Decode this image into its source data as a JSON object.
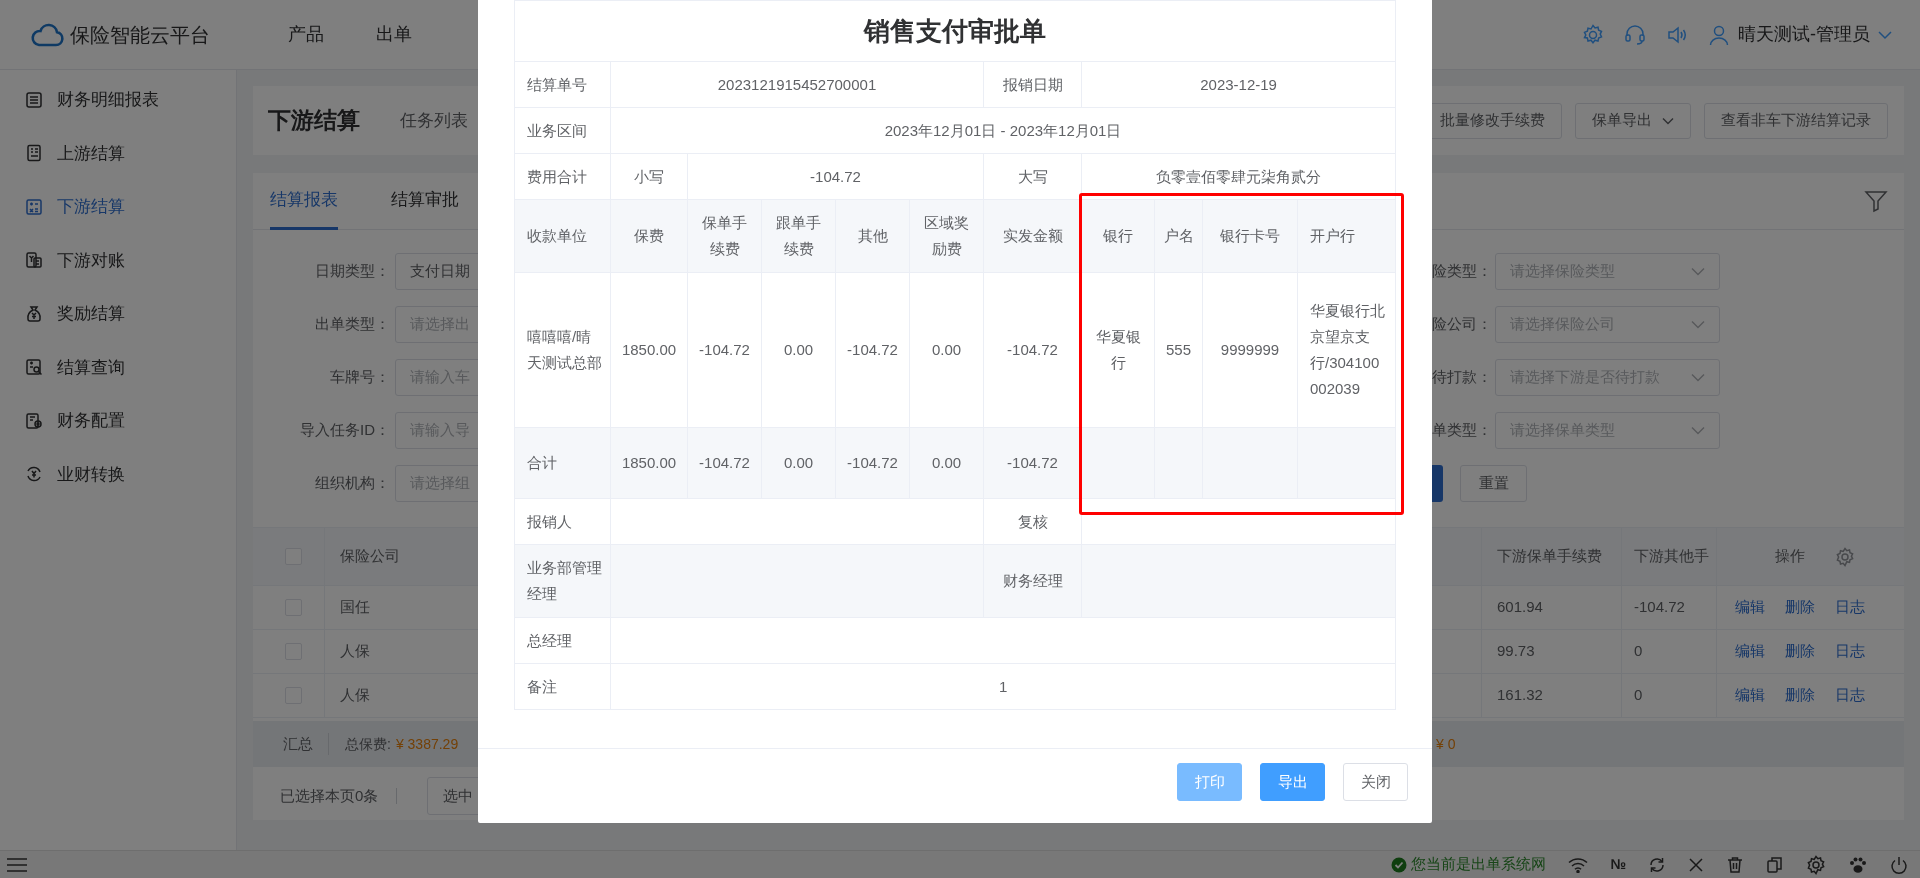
{
  "app": {
    "logo": "保险智能云平台",
    "nav": [
      {
        "label": "产品"
      },
      {
        "label": "出单"
      }
    ],
    "user": "晴天测试-管理员"
  },
  "sidebar": {
    "items": [
      {
        "label": "财务明细报表",
        "selected": false
      },
      {
        "label": "上游结算",
        "selected": false
      },
      {
        "label": "下游结算",
        "selected": true
      },
      {
        "label": "下游对账",
        "selected": false
      },
      {
        "label": "奖励结算",
        "selected": false
      },
      {
        "label": "结算查询",
        "selected": false
      },
      {
        "label": "财务配置",
        "selected": false
      },
      {
        "label": "业财转换",
        "selected": false
      }
    ]
  },
  "header": {
    "title": "下游结算",
    "breadcrumb": "任务列表",
    "actions": [
      {
        "label": "批量修改手续费",
        "kind": "button"
      },
      {
        "label": "保单导出",
        "kind": "dropdown"
      },
      {
        "label": "查看非车下游结算记录",
        "kind": "button"
      }
    ]
  },
  "tabs": [
    {
      "label": "结算报表",
      "selected": true
    },
    {
      "label": "结算审批",
      "selected": false
    }
  ],
  "filters_left": [
    {
      "label": "日期类型：",
      "value": "支付日期"
    },
    {
      "label": "出单类型：",
      "placeholder": "请选择出"
    },
    {
      "label": "车牌号：",
      "placeholder": "请输入车"
    },
    {
      "label": "导入任务ID：",
      "placeholder": "请输入导"
    },
    {
      "label": "组织机构：",
      "placeholder": "请选择组"
    }
  ],
  "filters_right": [
    {
      "label": "险类型：",
      "placeholder": "请选择保险类型"
    },
    {
      "label": "险公司：",
      "placeholder": "请选择保险公司"
    },
    {
      "label": "待打款：",
      "placeholder": "请选择下游是否待打款"
    },
    {
      "label": "单类型：",
      "placeholder": "请选择保单类型"
    }
  ],
  "reset_button": "重置",
  "table": {
    "header_checked": false,
    "columns": [
      "保险公司",
      "下游保单手续费",
      "下游其他手",
      "操作"
    ],
    "rows": [
      {
        "checked": false,
        "company": "国任",
        "policy_fee": "601.94",
        "other_fee": "-104.72",
        "actions": [
          "编辑",
          "删除",
          "日志"
        ]
      },
      {
        "checked": false,
        "company": "人保",
        "policy_fee": "99.73",
        "other_fee": "0",
        "actions": [
          "编辑",
          "删除",
          "日志"
        ]
      },
      {
        "checked": false,
        "company": "人保",
        "policy_fee": "161.32",
        "other_fee": "0",
        "actions": [
          "编辑",
          "删除",
          "日志"
        ]
      }
    ],
    "summary": {
      "label": "汇总",
      "premium_label": "总保费:",
      "premium": "¥ 3387.29",
      "other": "¥ 0"
    },
    "selected_info": "已选择本页0条",
    "bulk_button": "选中"
  },
  "dialog": {
    "title": "销售支付审批单",
    "settlement_no_label": "结算单号",
    "settlement_no": "2023121915452700001",
    "claim_date_label": "报销日期",
    "claim_date": "2023-12-19",
    "period_label": "业务区间",
    "period": "2023年12月01日 - 2023年12月01日",
    "total_label": "费用合计",
    "amount_small_label": "小写",
    "amount_small": "-104.72",
    "amount_big_label": "大写",
    "amount_big": "负零壹佰零肆元柒角贰分",
    "columns": [
      "收款单位",
      "保费",
      "保单手续费",
      "跟单手续费",
      "其他",
      "区域奖励费",
      "实发金额",
      "银行",
      "户名",
      "银行卡号",
      "开户行"
    ],
    "rows": [
      {
        "cells": [
          "嘻嘻嘻/晴天测试总部",
          "1850.00",
          "-104.72",
          "0.00",
          "-104.72",
          "0.00",
          "-104.72",
          "华夏银行",
          "555",
          "9999999",
          "华夏银行北京望京支行/304100002039"
        ]
      }
    ],
    "total_row": {
      "label": "合计",
      "cells": [
        "1850.00",
        "-104.72",
        "0.00",
        "-104.72",
        "0.00",
        "-104.72"
      ]
    },
    "sign_rows": [
      {
        "left": "报销人",
        "right": "复核"
      },
      {
        "left": "业务部管理经理",
        "right": "财务经理"
      }
    ],
    "general_manager_label": "总经理",
    "remark_label": "备注",
    "remark": "1",
    "buttons": [
      {
        "label": "打印",
        "kind": "primary-light"
      },
      {
        "label": "导出",
        "kind": "primary"
      },
      {
        "label": "关闭",
        "kind": "default"
      }
    ]
  },
  "status_bar": {
    "message": "您当前是出单系统网",
    "number_sign": "№"
  }
}
